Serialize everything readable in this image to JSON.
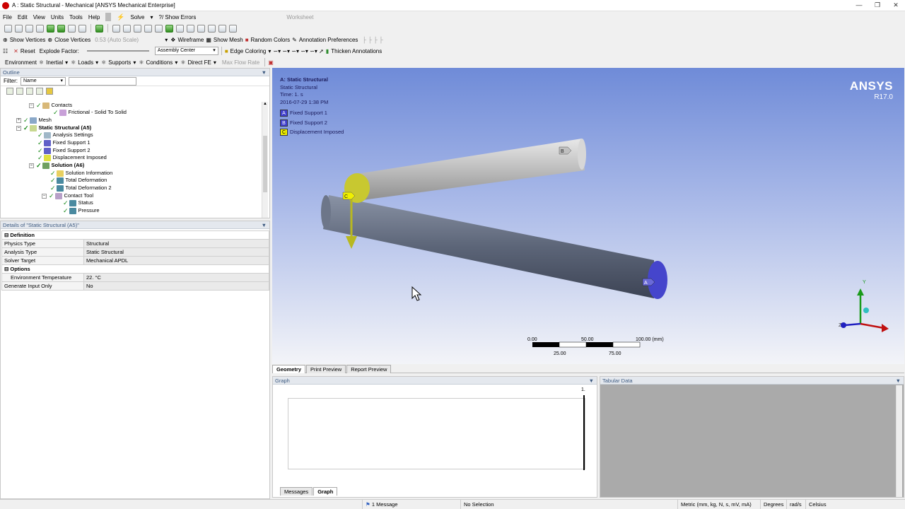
{
  "window": {
    "title": "A : Static Structural - Mechanical [ANSYS Mechanical Enterprise]"
  },
  "menu": [
    "File",
    "Edit",
    "View",
    "Units",
    "Tools",
    "Help"
  ],
  "toolbar1": {
    "solve": "Solve",
    "show_errors": "?/ Show Errors",
    "worksheet": "Worksheet"
  },
  "toolbar3": {
    "show_vertices": "Show Vertices",
    "close_vertices": "Close Vertices",
    "auto_scale": "0.53 (Auto Scale)",
    "wireframe": "Wireframe",
    "show_mesh": "Show Mesh",
    "random_colors": "Random Colors",
    "annotation_prefs": "Annotation Preferences"
  },
  "toolbar4": {
    "reset": "Reset",
    "explode_factor": "Explode Factor:",
    "assembly_center": "Assembly Center",
    "edge_coloring": "Edge Coloring",
    "thicken_annotations": "Thicken Annotations"
  },
  "toolbar5": {
    "environment": "Environment",
    "inertial": "Inertial",
    "loads": "Loads",
    "supports": "Supports",
    "conditions": "Conditions",
    "direct_fe": "Direct FE",
    "max_flow_rate": "Max Flow Rate"
  },
  "outline": {
    "title": "Outline",
    "filter_label": "Filter:",
    "filter_value": "Name",
    "nodes": {
      "contacts": "Contacts",
      "frictional": "Frictional - Solid To Solid",
      "mesh": "Mesh",
      "static_structural": "Static Structural (A5)",
      "analysis_settings": "Analysis Settings",
      "fixed_support_1": "Fixed Support 1",
      "fixed_support_2": "Fixed Support 2",
      "displacement_imposed": "Displacement Imposed",
      "solution": "Solution (A6)",
      "solution_info": "Solution Information",
      "total_deformation": "Total Deformation",
      "total_deformation_2": "Total Deformation 2",
      "contact_tool": "Contact Tool",
      "status": "Status",
      "pressure": "Pressure"
    }
  },
  "details": {
    "title": "Details of \"Static Structural (A5)\"",
    "sections": [
      {
        "name": "Definition",
        "rows": [
          {
            "key": "Physics Type",
            "value": "Structural"
          },
          {
            "key": "Analysis Type",
            "value": "Static Structural"
          },
          {
            "key": "Solver Target",
            "value": "Mechanical APDL"
          }
        ]
      },
      {
        "name": "Options",
        "rows": [
          {
            "key": "Environment Temperature",
            "value": "22. °C"
          },
          {
            "key": "Generate Input Only",
            "value": "No"
          }
        ]
      }
    ]
  },
  "viewport": {
    "heading": "A: Static Structural",
    "subheading": "Static Structural",
    "time": "Time: 1. s",
    "date": "2016-07-29 1:38 PM",
    "legend": [
      {
        "tag": "A",
        "label": "Fixed Support 1",
        "color": "#4040d0"
      },
      {
        "tag": "B",
        "label": "Fixed Support 2",
        "color": "#4040d0"
      },
      {
        "tag": "C",
        "label": "Displacement Imposed",
        "color": "#f0f000"
      }
    ],
    "brand": "ANSYS",
    "version": "R17.0",
    "scale_labels_top": [
      "0.00",
      "50.00",
      "100.00 (mm)"
    ],
    "scale_labels_bottom": [
      "25.00",
      "75.00"
    ],
    "triad_y": "Y",
    "triad_z": "Z"
  },
  "view_tabs": [
    "Geometry",
    "Print Preview",
    "Report Preview"
  ],
  "graph": {
    "title": "Graph",
    "marker": "1.",
    "tabs": [
      "Messages",
      "Graph"
    ]
  },
  "tabular": {
    "title": "Tabular Data"
  },
  "status": {
    "message": "1 Message",
    "selection": "No Selection",
    "units": "Metric (mm, kg, N, s, mV, mA)",
    "angle": "Degrees",
    "rot": "rad/s",
    "temp": "Celsius"
  },
  "colors": {
    "accent": "#3d5a80",
    "support": "#4040d0",
    "displacement": "#f0f000"
  }
}
